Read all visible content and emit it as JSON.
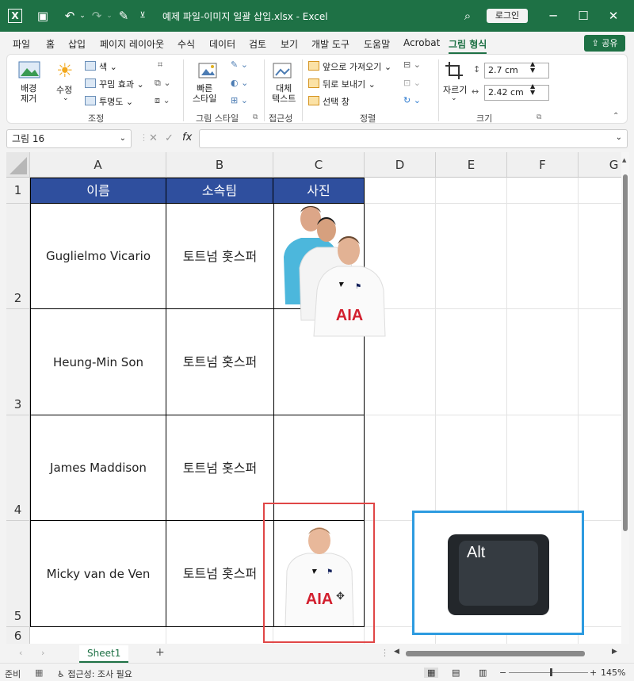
{
  "window": {
    "title": "예제 파일-이미지 일괄 삽입.xlsx  -  Excel",
    "login_label": "로그인"
  },
  "menu": {
    "items": [
      "파일",
      "홈",
      "삽입",
      "페이지 레이아웃",
      "수식",
      "데이터",
      "검토",
      "보기",
      "개발 도구",
      "도움말",
      "Acrobat",
      "그림 형식"
    ],
    "share_label": "공유"
  },
  "ribbon": {
    "remove_bg": "배경\n제거",
    "corrections": "수정",
    "color": "색",
    "artistic": "꾸밈 효과",
    "transparency": "투명도",
    "adjust_group": "조정",
    "quick_styles": "빠른\n스타일",
    "picture_styles_group": "그림 스타일",
    "alt_text": "대체\n텍스트",
    "accessibility_group": "접근성",
    "bring_forward": "앞으로 가져오기",
    "send_backward": "뒤로 보내기",
    "selection_pane": "선택 창",
    "arrange_group": "정렬",
    "crop": "자르기",
    "height": "2.7 cm",
    "width": "2.42 cm",
    "size_group": "크기"
  },
  "formula_bar": {
    "name_box": "그림 16",
    "fx": "fx",
    "formula": ""
  },
  "sheet": {
    "columns": [
      "A",
      "B",
      "C",
      "D",
      "E",
      "F",
      "G"
    ],
    "rows": [
      "1",
      "2",
      "3",
      "4",
      "5",
      "6"
    ],
    "headers": [
      "이름",
      "소속팀",
      "사진"
    ],
    "data": [
      {
        "name": "Guglielmo Vicario",
        "team": "토트넘 홋스퍼"
      },
      {
        "name": "Heung-Min Son",
        "team": "토트넘 홋스퍼"
      },
      {
        "name": "James Maddison",
        "team": "토트넘 홋스퍼"
      },
      {
        "name": "Micky van de Ven",
        "team": "토트넘 홋스퍼"
      }
    ],
    "shirt_sponsor": "AIA",
    "alt_key_label": "Alt"
  },
  "tabs": {
    "sheet_name": "Sheet1",
    "add": "+"
  },
  "status": {
    "ready": "준비",
    "accessibility": "접근성: 조사 필요",
    "zoom": "145%"
  },
  "colors": {
    "excel_green": "#1e7145",
    "header_fill": "#2f4f9e",
    "red_highlight": "#e04646",
    "blue_highlight": "#2d9be0",
    "key_bg": "#23272b"
  }
}
